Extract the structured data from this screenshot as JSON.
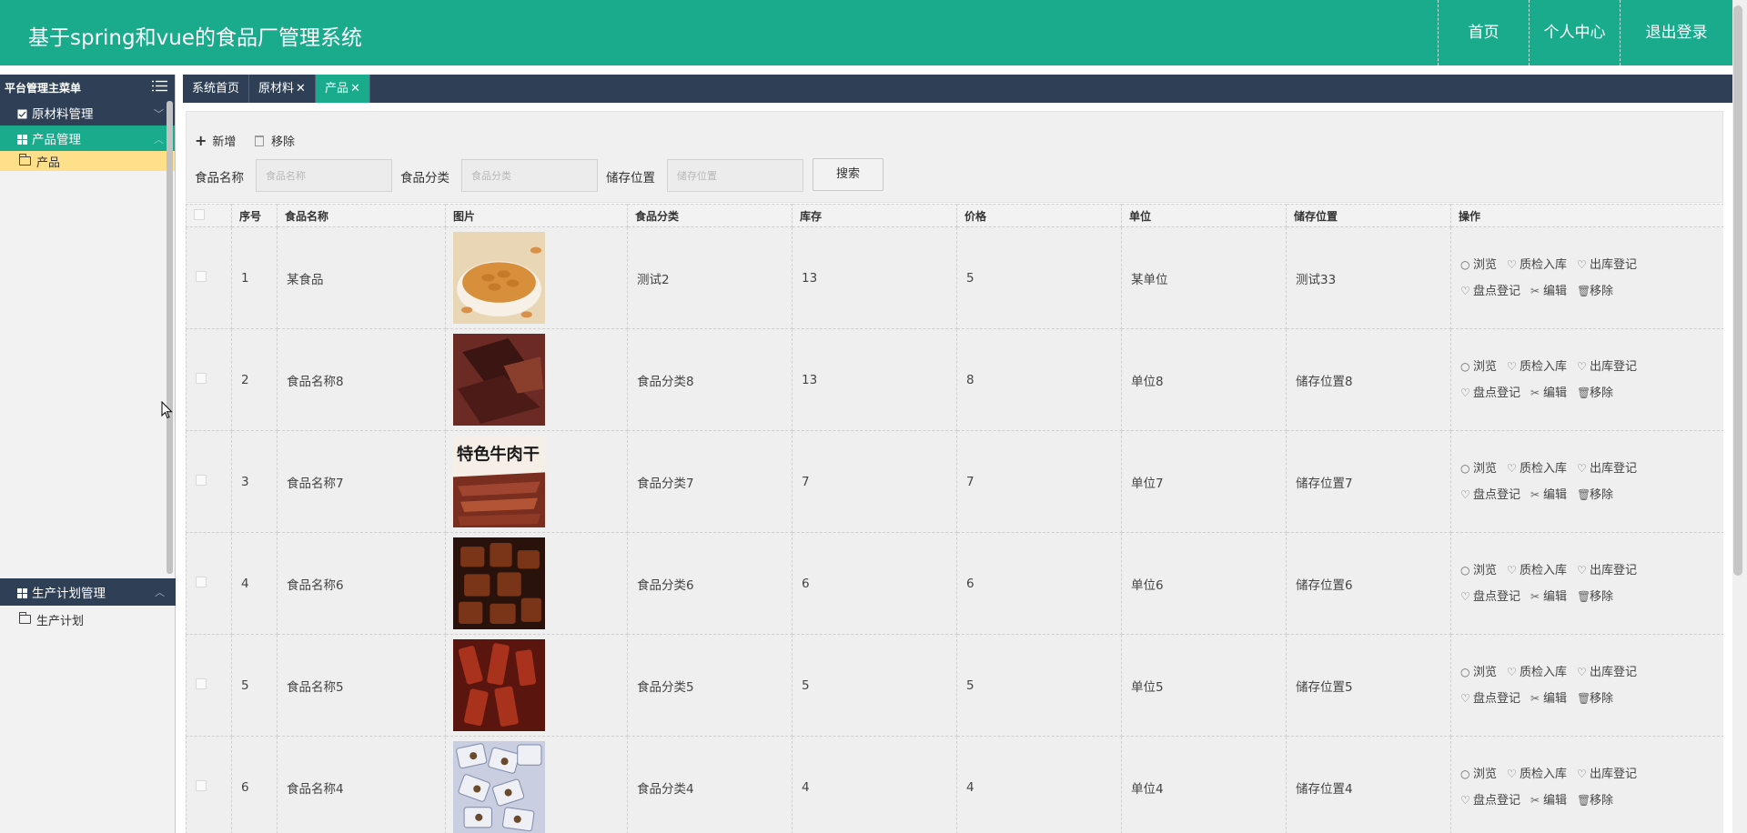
{
  "app": {
    "title": "基于spring和vue的食品厂管理系统",
    "nav": [
      "首页",
      "个人中心",
      "退出登录"
    ]
  },
  "sidebar": {
    "header": "平台管理主菜单",
    "groups": [
      {
        "label": "原材料管理",
        "expanded": false,
        "items": []
      },
      {
        "label": "产品管理",
        "expanded": true,
        "items": [
          "产品"
        ]
      },
      {
        "label": "生产计划管理",
        "expanded": true,
        "items": [
          "生产计划"
        ]
      }
    ]
  },
  "tabs": [
    {
      "label": "系统首页",
      "closable": false,
      "active": false
    },
    {
      "label": "原材料",
      "closable": true,
      "active": false
    },
    {
      "label": "产品",
      "closable": true,
      "active": true
    }
  ],
  "toolbar": {
    "add_label": "新增",
    "remove_label": "移除",
    "fields": [
      {
        "label": "食品名称",
        "placeholder": "食品名称",
        "value": ""
      },
      {
        "label": "食品分类",
        "placeholder": "食品分类",
        "value": ""
      },
      {
        "label": "储存位置",
        "placeholder": "储存位置",
        "value": ""
      }
    ],
    "search_label": "搜索"
  },
  "table": {
    "columns": [
      "序号",
      "食品名称",
      "图片",
      "食品分类",
      "库存",
      "价格",
      "单位",
      "储存位置",
      "操作"
    ],
    "actions": [
      "浏览",
      "质检入库",
      "出库登记",
      "盘点登记",
      "编辑",
      "移除"
    ],
    "rows": [
      {
        "no": "1",
        "name": "某食品",
        "image": "cashews-photo",
        "category": "测试2",
        "stock": "13",
        "price": "5",
        "unit": "某单位",
        "location": "测试33"
      },
      {
        "no": "2",
        "name": "食品名称8",
        "image": "beef-jerky-photo",
        "category": "食品分类8",
        "stock": "13",
        "price": "8",
        "unit": "单位8",
        "location": "储存位置8"
      },
      {
        "no": "3",
        "name": "食品名称7",
        "image": "special-beef-jerky-poster",
        "image_text": "特色牛肉干",
        "category": "食品分类7",
        "stock": "7",
        "price": "7",
        "unit": "单位7",
        "location": "储存位置7"
      },
      {
        "no": "4",
        "name": "食品名称6",
        "image": "braised-meat-photo",
        "category": "食品分类6",
        "stock": "6",
        "price": "6",
        "unit": "单位6",
        "location": "储存位置6"
      },
      {
        "no": "5",
        "name": "食品名称5",
        "image": "spicy-beef-strips-photo",
        "category": "食品分类5",
        "stock": "5",
        "price": "5",
        "unit": "单位5",
        "location": "储存位置5"
      },
      {
        "no": "6",
        "name": "食品名称4",
        "image": "packaged-snacks-photo",
        "category": "食品分类4",
        "stock": "4",
        "price": "4",
        "unit": "单位4",
        "location": "储存位置4"
      }
    ]
  },
  "colors": {
    "brand": "#19ab8c",
    "dark_nav": "#2f4056",
    "active_item": "#ffe08a"
  }
}
